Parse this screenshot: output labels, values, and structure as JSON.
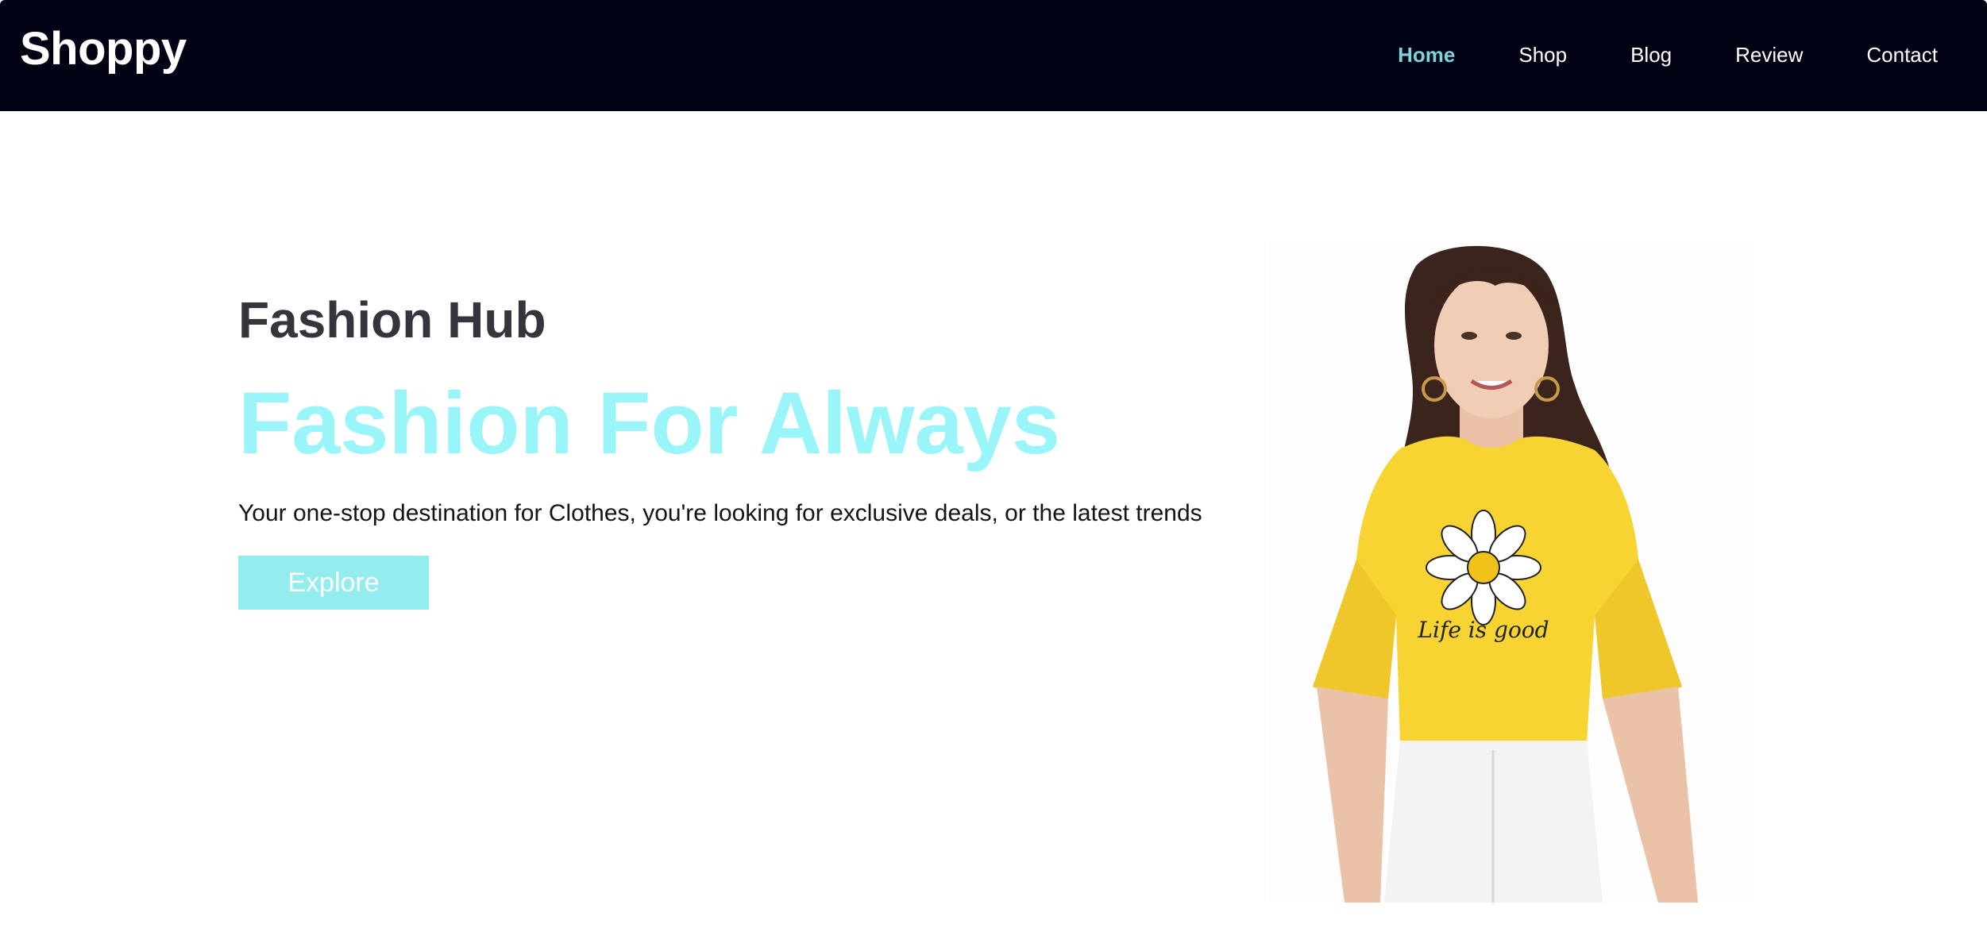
{
  "brand": {
    "logo": "Shoppy"
  },
  "nav": {
    "items": [
      {
        "label": "Home",
        "active": true
      },
      {
        "label": "Shop",
        "active": false
      },
      {
        "label": "Blog",
        "active": false
      },
      {
        "label": "Review",
        "active": false
      },
      {
        "label": "Contact",
        "active": false
      }
    ]
  },
  "hero": {
    "subtitle": "Fashion Hub",
    "title": "Fashion For Always",
    "description": "Your one-stop destination for Clothes, you're looking for exclusive deals, or the latest trends",
    "cta_label": "Explore",
    "image_print_text": "Life is good"
  },
  "colors": {
    "navbar_bg": "#010315",
    "nav_active": "#7fd3dc",
    "title_accent": "#9af5f8",
    "button_bg": "#93ecee",
    "shirt": "#f7d431"
  }
}
